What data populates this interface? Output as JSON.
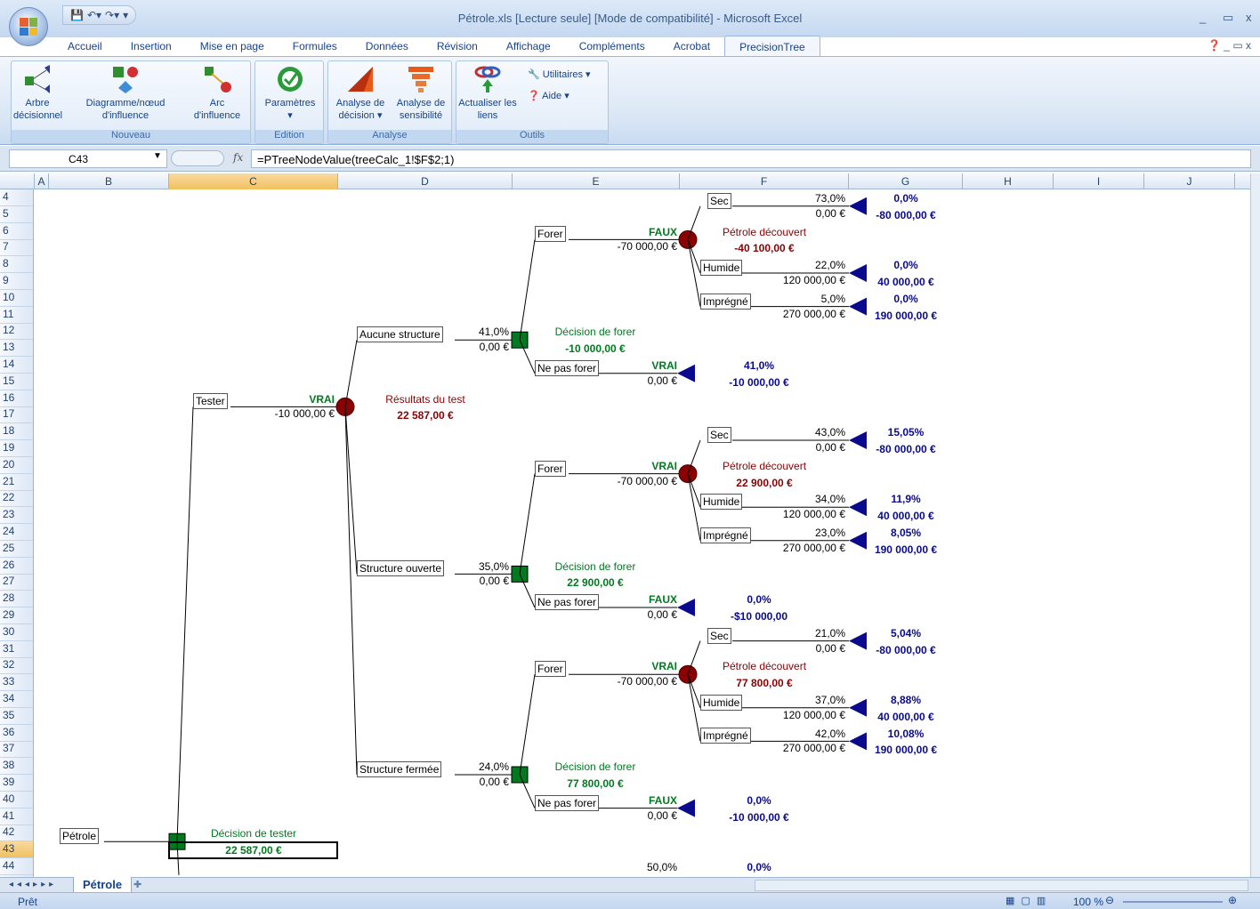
{
  "window": {
    "title": "Pétrole.xls  [Lecture seule]  [Mode de compatibilité] - Microsoft Excel",
    "controls": [
      "_",
      "▭",
      "x"
    ]
  },
  "ribbon_tabs": [
    "Accueil",
    "Insertion",
    "Mise en page",
    "Formules",
    "Données",
    "Révision",
    "Affichage",
    "Compléments",
    "Acrobat",
    "PrecisionTree"
  ],
  "active_tab": "PrecisionTree",
  "ribbon": {
    "nouveau": {
      "title": "Nouveau",
      "arbre": "Arbre décisionnel",
      "diagramme": "Diagramme/nœud d'influence",
      "arc": "Arc d'influence"
    },
    "edition": {
      "title": "Edition",
      "parametres": "Paramètres"
    },
    "analyse": {
      "title": "Analyse",
      "decision": "Analyse de décision",
      "sensibilite": "Analyse de sensibilité"
    },
    "outils": {
      "title": "Outils",
      "actualiser": "Actualiser les liens",
      "utilitaires": "Utilitaires",
      "aide": "Aide"
    }
  },
  "formula_bar": {
    "name_box": "C43",
    "formula": "=PTreeNodeValue(treeCalc_1!$F$2;1)"
  },
  "columns": [
    "A",
    "B",
    "C",
    "D",
    "E",
    "F",
    "G",
    "H",
    "I",
    "J"
  ],
  "selected_column": "C",
  "rows": [
    4,
    5,
    6,
    7,
    8,
    9,
    10,
    11,
    12,
    13,
    14,
    15,
    16,
    17,
    18,
    19,
    20,
    21,
    22,
    23,
    24,
    25,
    26,
    27,
    28,
    29,
    30,
    31,
    32,
    33,
    34,
    35,
    36,
    37,
    38,
    39,
    40,
    41,
    42,
    43,
    44
  ],
  "selected_row": 43,
  "tree": {
    "root": {
      "name": "Pétrole",
      "node_label": "Décision de tester",
      "node_value": "22 587,00 €"
    },
    "tester": {
      "label": "Tester",
      "flag": "VRAI",
      "cost": "-10 000,00 €",
      "node_label": "Résultats du test",
      "node_value": "22 587,00 €"
    },
    "branches": [
      {
        "label": "Aucune structure",
        "prob": "41,0%",
        "value": "0,00 €",
        "decision_label": "Décision de forer",
        "decision_value": "-10 000,00 €",
        "forer": {
          "label": "Forer",
          "flag": "FAUX",
          "cost": "-70 000,00 €",
          "chance_label": "Pétrole découvert",
          "chance_value": "-40 100,00 €",
          "outcomes": [
            {
              "label": "Sec",
              "prob": "73,0%",
              "value": "0,00 €",
              "end_prob": "0,0%",
              "end_value": "-80 000,00 €"
            },
            {
              "label": "Humide",
              "prob": "22,0%",
              "value": "120 000,00 €",
              "end_prob": "0,0%",
              "end_value": "40 000,00 €"
            },
            {
              "label": "Imprégné",
              "prob": "5,0%",
              "value": "270 000,00 €",
              "end_prob": "0,0%",
              "end_value": "190 000,00 €"
            }
          ]
        },
        "ne_pas_forer": {
          "label": "Ne pas forer",
          "flag": "VRAI",
          "value": "0,00 €",
          "end_prob": "41,0%",
          "end_value": "-10 000,00 €"
        }
      },
      {
        "label": "Structure ouverte",
        "prob": "35,0%",
        "value": "0,00 €",
        "decision_label": "Décision de forer",
        "decision_value": "22 900,00 €",
        "forer": {
          "label": "Forer",
          "flag": "VRAI",
          "cost": "-70 000,00 €",
          "chance_label": "Pétrole découvert",
          "chance_value": "22 900,00 €",
          "outcomes": [
            {
              "label": "Sec",
              "prob": "43,0%",
              "value": "0,00 €",
              "end_prob": "15,05%",
              "end_value": "-80 000,00 €"
            },
            {
              "label": "Humide",
              "prob": "34,0%",
              "value": "120 000,00 €",
              "end_prob": "11,9%",
              "end_value": "40 000,00 €"
            },
            {
              "label": "Imprégné",
              "prob": "23,0%",
              "value": "270 000,00 €",
              "end_prob": "8,05%",
              "end_value": "190 000,00 €"
            }
          ]
        },
        "ne_pas_forer": {
          "label": "Ne pas forer",
          "flag": "FAUX",
          "value": "0,00 €",
          "end_prob": "0,0%",
          "end_value": "-$10 000,00"
        }
      },
      {
        "label": "Structure fermée",
        "prob": "24,0%",
        "value": "0,00 €",
        "decision_label": "Décision de forer",
        "decision_value": "77 800,00 €",
        "forer": {
          "label": "Forer",
          "flag": "VRAI",
          "cost": "-70 000,00 €",
          "chance_label": "Pétrole découvert",
          "chance_value": "77 800,00 €",
          "outcomes": [
            {
              "label": "Sec",
              "prob": "21,0%",
              "value": "0,00 €",
              "end_prob": "5,04%",
              "end_value": "-80 000,00 €"
            },
            {
              "label": "Humide",
              "prob": "37,0%",
              "value": "120 000,00 €",
              "end_prob": "8,88%",
              "end_value": "40 000,00 €"
            },
            {
              "label": "Imprégné",
              "prob": "42,0%",
              "value": "270 000,00 €",
              "end_prob": "10,08%",
              "end_value": "190 000,00 €"
            }
          ]
        },
        "ne_pas_forer": {
          "label": "Ne pas forer",
          "flag": "FAUX",
          "value": "0,00 €",
          "end_prob": "0,0%",
          "end_value": "-10 000,00 €"
        }
      }
    ],
    "partial_row": {
      "prob": "50,0%",
      "end_prob": "0,0%"
    }
  },
  "colors": {
    "decision": "#007a1f",
    "chance": "#8b0000",
    "end": "#0a0a8f"
  },
  "sheet_tab": "Pétrole",
  "status": "Prêt",
  "zoom": "100 %"
}
